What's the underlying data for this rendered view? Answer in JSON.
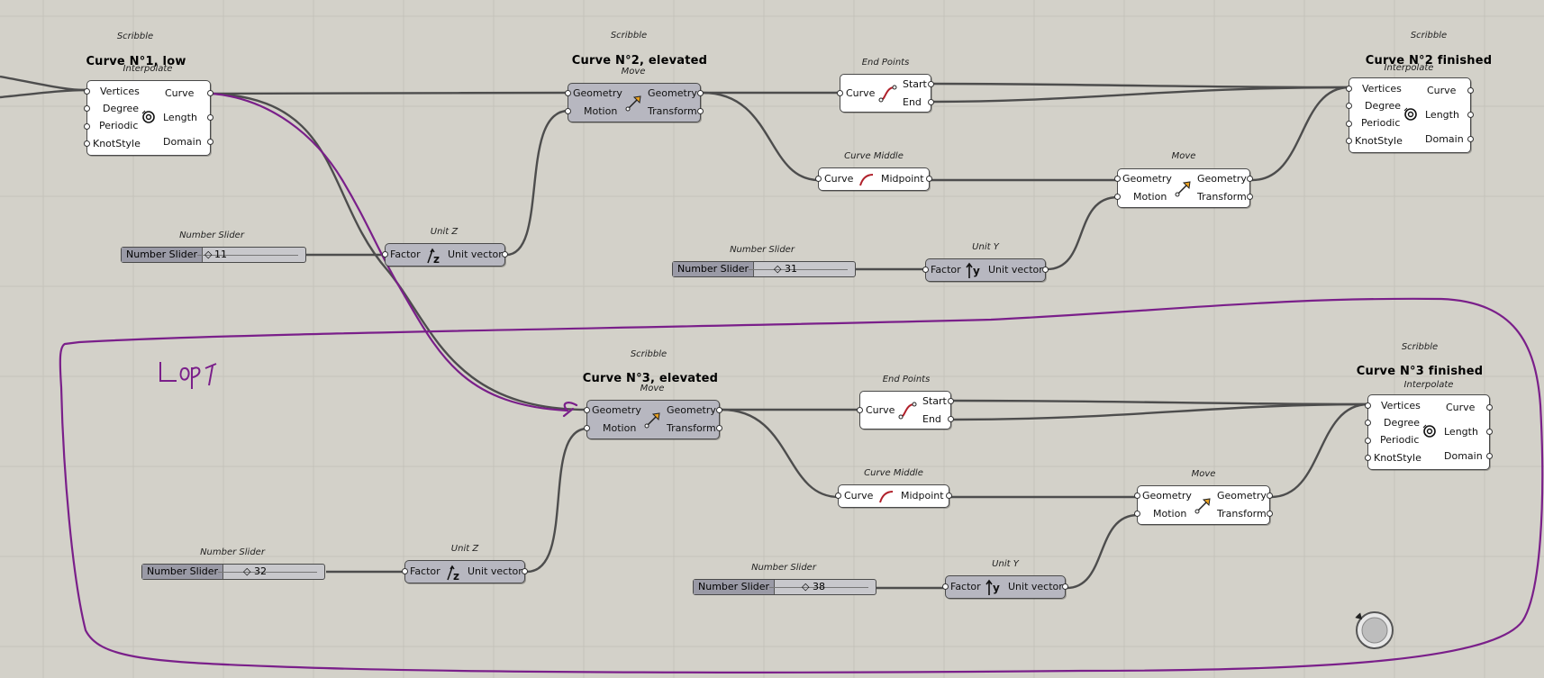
{
  "scribbles": {
    "s1": "Scribble",
    "s2": "Scribble",
    "s3": "Scribble",
    "s4": "Scribble",
    "s5": "Scribble",
    "c1": "Curve N°1, low",
    "c2": "Curve N°2, elevated",
    "c2f": "Curve N°2 finished",
    "c3": "Curve N°3, elevated",
    "c3f": "Curve N°3 finished"
  },
  "components": {
    "interpolate": {
      "title": "Interpolate",
      "inputs": [
        "Vertices",
        "Degree",
        "Periodic",
        "KnotStyle"
      ],
      "outputs": [
        "Curve",
        "Length",
        "Domain"
      ]
    },
    "move": {
      "title": "Move",
      "inputs": [
        "Geometry",
        "Motion"
      ],
      "outputs": [
        "Geometry",
        "Transform"
      ]
    },
    "endpoints": {
      "title": "End Points",
      "input": "Curve",
      "outputs": [
        "Start",
        "End"
      ]
    },
    "curvemiddle": {
      "title": "Curve Middle",
      "input": "Curve",
      "output": "Midpoint"
    },
    "unitz": {
      "title": "Unit Z",
      "input": "Factor",
      "output": "Unit vector"
    },
    "unity": {
      "title": "Unit Y",
      "input": "Factor",
      "output": "Unit vector"
    },
    "slidertitle": "Number Slider"
  },
  "sliders": [
    {
      "label": "Number Slider",
      "value": "11",
      "fraction": 0.0
    },
    {
      "label": "Number Slider",
      "value": "31",
      "fraction": 0.3
    },
    {
      "label": "Number Slider",
      "value": "32",
      "fraction": 0.3
    },
    {
      "label": "Number Slider",
      "value": "38",
      "fraction": 0.35
    }
  ],
  "annotation": {
    "loop_label": "Loop",
    "color": "#7a1f8a"
  },
  "colors": {
    "canvas": "#d3d1c9",
    "wire": "#4d4d4d",
    "annotation": "#7a1f8a"
  }
}
